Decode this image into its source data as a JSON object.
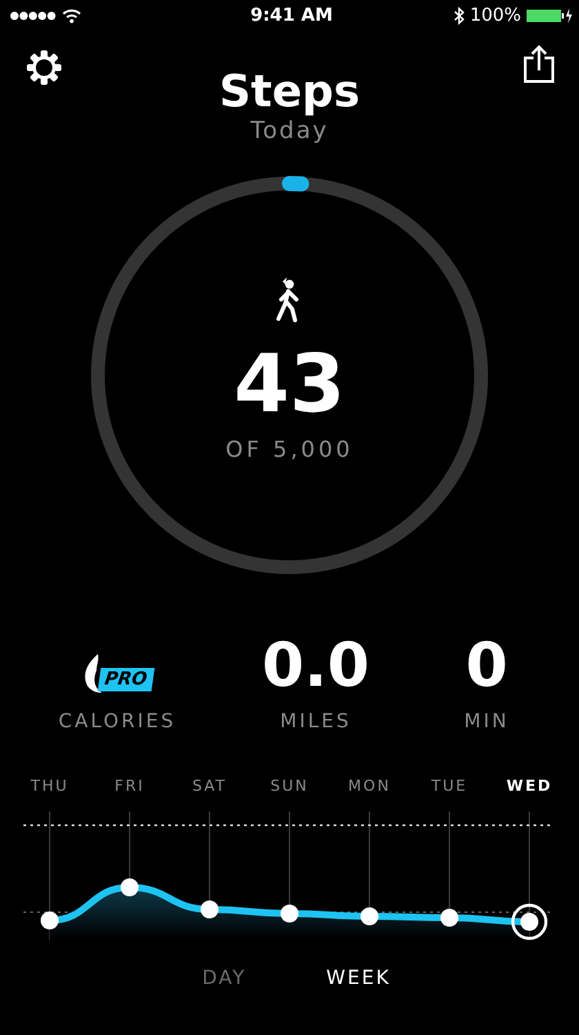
{
  "status_bar": {
    "time": "9:41 AM",
    "battery": "100%"
  },
  "header": {
    "title": "Steps",
    "subtitle": "Today"
  },
  "goal": {
    "count": "43",
    "target": "OF 5,000"
  },
  "stats": [
    {
      "kind": "badge",
      "badge": "PRO",
      "label": "CALORIES"
    },
    {
      "kind": "value",
      "value": "0.0",
      "label": "MILES"
    },
    {
      "kind": "value",
      "value": "0",
      "label": "MIN"
    }
  ],
  "days": [
    {
      "label": "THU",
      "selected": false
    },
    {
      "label": "FRI",
      "selected": false
    },
    {
      "label": "SAT",
      "selected": false
    },
    {
      "label": "SUN",
      "selected": false
    },
    {
      "label": "MON",
      "selected": false
    },
    {
      "label": "TUE",
      "selected": false
    },
    {
      "label": "WED",
      "selected": true
    }
  ],
  "tabs": [
    {
      "label": "DAY",
      "selected": false
    },
    {
      "label": "WEEK",
      "selected": true
    }
  ]
}
